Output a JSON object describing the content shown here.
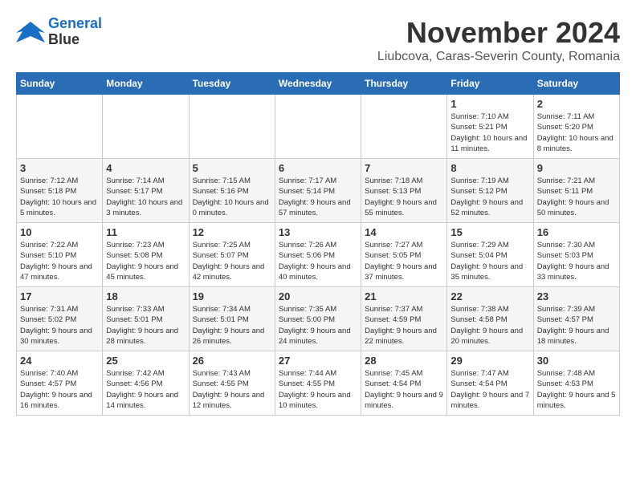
{
  "logo": {
    "line1": "General",
    "line2": "Blue"
  },
  "title": "November 2024",
  "location": "Liubcova, Caras-Severin County, Romania",
  "days_of_week": [
    "Sunday",
    "Monday",
    "Tuesday",
    "Wednesday",
    "Thursday",
    "Friday",
    "Saturday"
  ],
  "weeks": [
    [
      {
        "day": "",
        "info": ""
      },
      {
        "day": "",
        "info": ""
      },
      {
        "day": "",
        "info": ""
      },
      {
        "day": "",
        "info": ""
      },
      {
        "day": "",
        "info": ""
      },
      {
        "day": "1",
        "info": "Sunrise: 7:10 AM\nSunset: 5:21 PM\nDaylight: 10 hours and 11 minutes."
      },
      {
        "day": "2",
        "info": "Sunrise: 7:11 AM\nSunset: 5:20 PM\nDaylight: 10 hours and 8 minutes."
      }
    ],
    [
      {
        "day": "3",
        "info": "Sunrise: 7:12 AM\nSunset: 5:18 PM\nDaylight: 10 hours and 5 minutes."
      },
      {
        "day": "4",
        "info": "Sunrise: 7:14 AM\nSunset: 5:17 PM\nDaylight: 10 hours and 3 minutes."
      },
      {
        "day": "5",
        "info": "Sunrise: 7:15 AM\nSunset: 5:16 PM\nDaylight: 10 hours and 0 minutes."
      },
      {
        "day": "6",
        "info": "Sunrise: 7:17 AM\nSunset: 5:14 PM\nDaylight: 9 hours and 57 minutes."
      },
      {
        "day": "7",
        "info": "Sunrise: 7:18 AM\nSunset: 5:13 PM\nDaylight: 9 hours and 55 minutes."
      },
      {
        "day": "8",
        "info": "Sunrise: 7:19 AM\nSunset: 5:12 PM\nDaylight: 9 hours and 52 minutes."
      },
      {
        "day": "9",
        "info": "Sunrise: 7:21 AM\nSunset: 5:11 PM\nDaylight: 9 hours and 50 minutes."
      }
    ],
    [
      {
        "day": "10",
        "info": "Sunrise: 7:22 AM\nSunset: 5:10 PM\nDaylight: 9 hours and 47 minutes."
      },
      {
        "day": "11",
        "info": "Sunrise: 7:23 AM\nSunset: 5:08 PM\nDaylight: 9 hours and 45 minutes."
      },
      {
        "day": "12",
        "info": "Sunrise: 7:25 AM\nSunset: 5:07 PM\nDaylight: 9 hours and 42 minutes."
      },
      {
        "day": "13",
        "info": "Sunrise: 7:26 AM\nSunset: 5:06 PM\nDaylight: 9 hours and 40 minutes."
      },
      {
        "day": "14",
        "info": "Sunrise: 7:27 AM\nSunset: 5:05 PM\nDaylight: 9 hours and 37 minutes."
      },
      {
        "day": "15",
        "info": "Sunrise: 7:29 AM\nSunset: 5:04 PM\nDaylight: 9 hours and 35 minutes."
      },
      {
        "day": "16",
        "info": "Sunrise: 7:30 AM\nSunset: 5:03 PM\nDaylight: 9 hours and 33 minutes."
      }
    ],
    [
      {
        "day": "17",
        "info": "Sunrise: 7:31 AM\nSunset: 5:02 PM\nDaylight: 9 hours and 30 minutes."
      },
      {
        "day": "18",
        "info": "Sunrise: 7:33 AM\nSunset: 5:01 PM\nDaylight: 9 hours and 28 minutes."
      },
      {
        "day": "19",
        "info": "Sunrise: 7:34 AM\nSunset: 5:01 PM\nDaylight: 9 hours and 26 minutes."
      },
      {
        "day": "20",
        "info": "Sunrise: 7:35 AM\nSunset: 5:00 PM\nDaylight: 9 hours and 24 minutes."
      },
      {
        "day": "21",
        "info": "Sunrise: 7:37 AM\nSunset: 4:59 PM\nDaylight: 9 hours and 22 minutes."
      },
      {
        "day": "22",
        "info": "Sunrise: 7:38 AM\nSunset: 4:58 PM\nDaylight: 9 hours and 20 minutes."
      },
      {
        "day": "23",
        "info": "Sunrise: 7:39 AM\nSunset: 4:57 PM\nDaylight: 9 hours and 18 minutes."
      }
    ],
    [
      {
        "day": "24",
        "info": "Sunrise: 7:40 AM\nSunset: 4:57 PM\nDaylight: 9 hours and 16 minutes."
      },
      {
        "day": "25",
        "info": "Sunrise: 7:42 AM\nSunset: 4:56 PM\nDaylight: 9 hours and 14 minutes."
      },
      {
        "day": "26",
        "info": "Sunrise: 7:43 AM\nSunset: 4:55 PM\nDaylight: 9 hours and 12 minutes."
      },
      {
        "day": "27",
        "info": "Sunrise: 7:44 AM\nSunset: 4:55 PM\nDaylight: 9 hours and 10 minutes."
      },
      {
        "day": "28",
        "info": "Sunrise: 7:45 AM\nSunset: 4:54 PM\nDaylight: 9 hours and 9 minutes."
      },
      {
        "day": "29",
        "info": "Sunrise: 7:47 AM\nSunset: 4:54 PM\nDaylight: 9 hours and 7 minutes."
      },
      {
        "day": "30",
        "info": "Sunrise: 7:48 AM\nSunset: 4:53 PM\nDaylight: 9 hours and 5 minutes."
      }
    ]
  ]
}
